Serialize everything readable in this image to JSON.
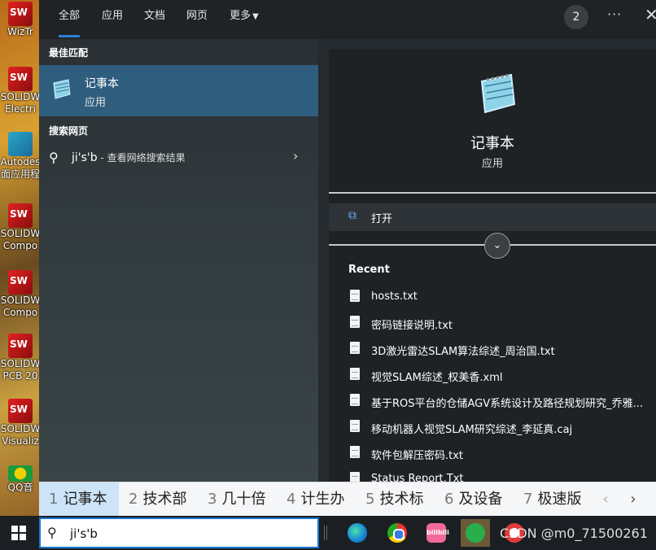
{
  "desktop": {
    "icons": [
      {
        "label": "WizTr",
        "kind": "sw"
      },
      {
        "label": "SOLIDW Electri",
        "kind": "sw"
      },
      {
        "label": "Autodes 面应用程",
        "kind": "ad"
      },
      {
        "label": "SOLIDW Compo",
        "kind": "sw"
      },
      {
        "label": "SOLIDW Compo",
        "kind": "sw"
      },
      {
        "label": "SOLIDW PCB 20",
        "kind": "sw"
      },
      {
        "label": "SOLIDW Visualiz",
        "kind": "sw"
      },
      {
        "label": "QQ音",
        "kind": "qq"
      }
    ]
  },
  "topnav": {
    "tabs": [
      {
        "label": "全部",
        "active": true
      },
      {
        "label": "应用"
      },
      {
        "label": "文档"
      },
      {
        "label": "网页"
      },
      {
        "label": "更多"
      }
    ],
    "more_caret": "▼",
    "badge": "2",
    "more_dots": "···",
    "close": "✕"
  },
  "left": {
    "best_match_title": "最佳匹配",
    "best_match": {
      "name": "记事本",
      "type": "应用"
    },
    "web_title": "搜索网页",
    "web_query": "ji's'b",
    "web_suffix": " - 查看网络搜索结果",
    "web_chevron": "›"
  },
  "right": {
    "app_name": "记事本",
    "app_type": "应用",
    "open_label": "打开",
    "open_icon": "⧉",
    "expand_icon": "⌄",
    "recent_title": "Recent",
    "recent": [
      "hosts.txt",
      "密码链接说明.txt",
      "3D激光雷达SLAM算法综述_周治国.txt",
      "视觉SLAM综述_权美香.xml",
      "基于ROS平台的仓储AGV系统设计及路径规划研究_乔雅...",
      "移动机器人视觉SLAM研究综述_李延真.caj",
      "软件包解压密码.txt",
      "Status Report.Txt"
    ]
  },
  "ime": {
    "candidates": [
      {
        "num": "1",
        "text": "记事本",
        "selected": true
      },
      {
        "num": "2",
        "text": "技术部"
      },
      {
        "num": "3",
        "text": "几十倍"
      },
      {
        "num": "4",
        "text": "计生办"
      },
      {
        "num": "5",
        "text": "技术标"
      },
      {
        "num": "6",
        "text": "及设备"
      },
      {
        "num": "7",
        "text": "极速版"
      }
    ],
    "prev": "‹",
    "next": "›"
  },
  "taskbar": {
    "search_value": "ji's'b",
    "search_icon": "⚲",
    "bili_text": "bilibili",
    "watermark": "CSDN @m0_71500261"
  }
}
